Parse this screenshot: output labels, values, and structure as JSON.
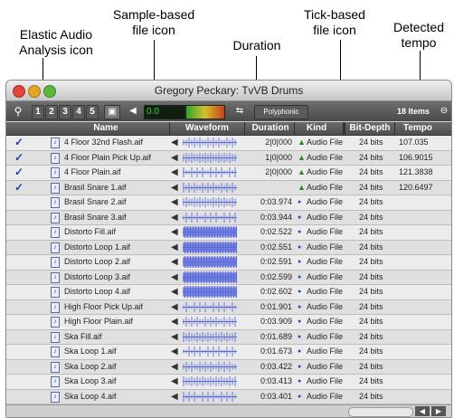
{
  "callouts": {
    "elastic": "Elastic Audio\nAnalysis icon",
    "sample_icon": "Sample-based\nfile icon",
    "duration": "Duration",
    "tick_icon": "Tick-based\nfile icon",
    "tempo": "Detected\ntempo"
  },
  "window": {
    "title": "Gregory Peckary: TvVB Drums",
    "item_count": "18 Items",
    "numbers": [
      "1",
      "2",
      "3",
      "4",
      "5"
    ],
    "level_readout": "0.0",
    "polyphonic_label": "Polyphonic"
  },
  "columns": {
    "name": "Name",
    "waveform": "Waveform",
    "duration": "Duration",
    "kind": "Kind",
    "bit_depth": "Bit-Depth",
    "tempo": "Tempo"
  },
  "rows": [
    {
      "check": "✓",
      "name": "4 Floor 32nd Flash.aif",
      "duration": "2|0|000",
      "kind": "Audio File",
      "bit": "24 bits",
      "tempo": "107.035",
      "kind_icon": "tick"
    },
    {
      "check": "✓",
      "name": "4 Floor Plain Pick Up.aif",
      "duration": "1|0|000",
      "kind": "Audio File",
      "bit": "24 bits",
      "tempo": "106.9015",
      "kind_icon": "tick"
    },
    {
      "check": "✓",
      "name": "4 Floor Plain.aif",
      "duration": "2|0|000",
      "kind": "Audio File",
      "bit": "24 bits",
      "tempo": "121.3838",
      "kind_icon": "tick"
    },
    {
      "check": "✓",
      "name": "Brasil Snare 1.aif",
      "duration": "",
      "kind": "Audio File",
      "bit": "24 bits",
      "tempo": "120.6497",
      "kind_icon": "tick"
    },
    {
      "check": "",
      "name": "Brasil Snare 2.aif",
      "duration": "0:03.974",
      "kind": "Audio File",
      "bit": "24 bits",
      "tempo": "",
      "kind_icon": "sample"
    },
    {
      "check": "",
      "name": "Brasil Snare 3.aif",
      "duration": "0:03.944",
      "kind": "Audio File",
      "bit": "24 bits",
      "tempo": "",
      "kind_icon": "sample"
    },
    {
      "check": "",
      "name": "Distorto Fill.aif",
      "duration": "0:02.522",
      "kind": "Audio File",
      "bit": "24 bits",
      "tempo": "",
      "kind_icon": "sample"
    },
    {
      "check": "",
      "name": "Distorto Loop 1.aif",
      "duration": "0:02.551",
      "kind": "Audio File",
      "bit": "24 bits",
      "tempo": "",
      "kind_icon": "sample"
    },
    {
      "check": "",
      "name": "Distorto Loop 2.aif",
      "duration": "0:02.591",
      "kind": "Audio File",
      "bit": "24 bits",
      "tempo": "",
      "kind_icon": "sample"
    },
    {
      "check": "",
      "name": "Distorto Loop 3.aif",
      "duration": "0:02.599",
      "kind": "Audio File",
      "bit": "24 bits",
      "tempo": "",
      "kind_icon": "sample"
    },
    {
      "check": "",
      "name": "Distorto Loop 4.aif",
      "duration": "0:02.602",
      "kind": "Audio File",
      "bit": "24 bits",
      "tempo": "",
      "kind_icon": "sample"
    },
    {
      "check": "",
      "name": "High Floor Pick Up.aif",
      "duration": "0:01.901",
      "kind": "Audio File",
      "bit": "24 bits",
      "tempo": "",
      "kind_icon": "sample"
    },
    {
      "check": "",
      "name": "High Floor Plain.aif",
      "duration": "0:03.909",
      "kind": "Audio File",
      "bit": "24 bits",
      "tempo": "",
      "kind_icon": "sample"
    },
    {
      "check": "",
      "name": "Ska Fill.aif",
      "duration": "0:01.689",
      "kind": "Audio File",
      "bit": "24 bits",
      "tempo": "",
      "kind_icon": "sample"
    },
    {
      "check": "",
      "name": "Ska Loop 1.aif",
      "duration": "0:01.673",
      "kind": "Audio File",
      "bit": "24 bits",
      "tempo": "",
      "kind_icon": "sample"
    },
    {
      "check": "",
      "name": "Ska Loop 2.aif",
      "duration": "0:03.422",
      "kind": "Audio File",
      "bit": "24 bits",
      "tempo": "",
      "kind_icon": "sample"
    },
    {
      "check": "",
      "name": "Ska Loop 3.aif",
      "duration": "0:03.413",
      "kind": "Audio File",
      "bit": "24 bits",
      "tempo": "",
      "kind_icon": "sample"
    },
    {
      "check": "",
      "name": "Ska Loop 4.aif",
      "duration": "0:03.401",
      "kind": "Audio File",
      "bit": "24 bits",
      "tempo": "",
      "kind_icon": "sample"
    }
  ],
  "colors": {
    "waveform": "#5b6bdc",
    "tick_icon": "#2a8a2a",
    "sample_icon": "#2a4fb0",
    "check": "#1a3fb4"
  },
  "icons": {
    "elastic": "checkmark-icon",
    "file": "audio-file-icon",
    "speaker": "speaker-icon",
    "tick": "metronome-icon",
    "sample": "waveform-dot-icon"
  }
}
